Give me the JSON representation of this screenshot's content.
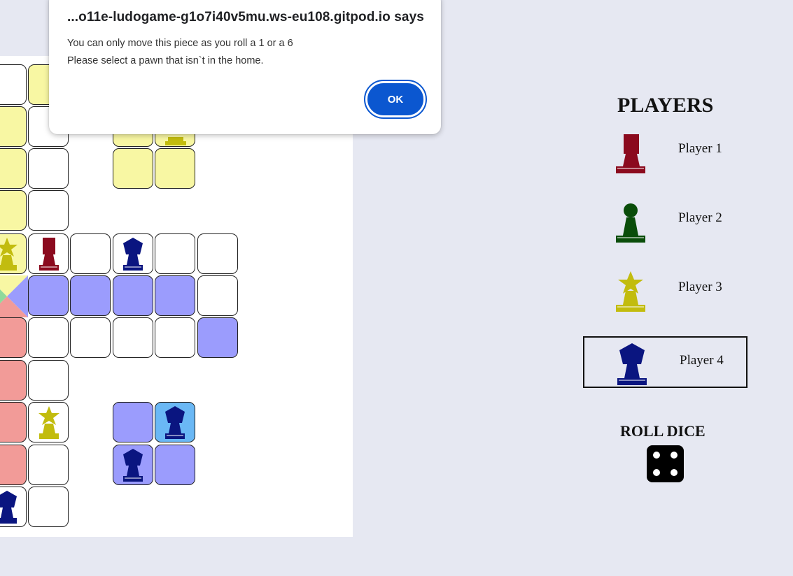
{
  "dialog": {
    "title": "...o11e-ludogame-g1o7i40v5mu.ws-eu108.gitpod.io says",
    "line1": "You can only move this piece as you roll a 1 or a 6",
    "line2": "Please select a pawn that isn`t in the home.",
    "ok_label": "OK"
  },
  "players": {
    "title": "PLAYERS",
    "list": [
      {
        "name": "Player 1",
        "color": "#8b0a1e",
        "icon": "rook-icon"
      },
      {
        "name": "Player 2",
        "color": "#0a4d0a",
        "icon": "pawn-icon"
      },
      {
        "name": "Player 3",
        "color": "#c2bc0e",
        "icon": "star-pawn-icon"
      },
      {
        "name": "Player 4",
        "color": "#0a1580",
        "icon": "pentagon-pawn-icon",
        "active": true
      }
    ]
  },
  "dice": {
    "label": "ROLL DICE",
    "value": 4
  },
  "colors": {
    "yellow_home": "#f8f7a3",
    "blue_home": "#9b9cfd",
    "red_home": "#f29b98",
    "highlight": "#6ab8f5",
    "background": "#e6e8f2",
    "dialog_button": "#0b57d0"
  }
}
